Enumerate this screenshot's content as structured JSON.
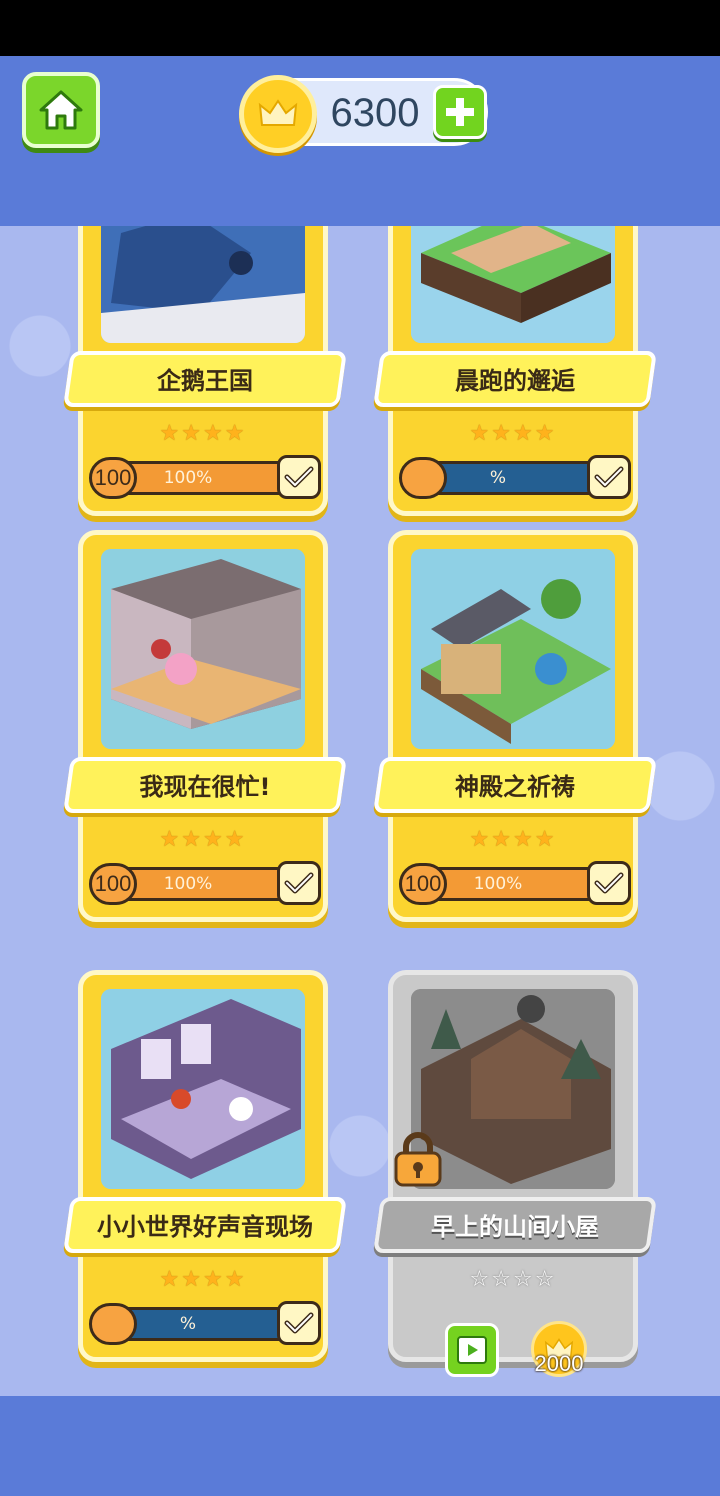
{
  "header": {
    "coins": "6300"
  },
  "colors": {
    "header": "#5a7bd8",
    "card": "#fbd42f",
    "locked_card": "#c9c9c9",
    "progress_fill": "#f39a35",
    "progress_track": "#245f92"
  },
  "levels": [
    {
      "title": "企鹅王国",
      "stars": "★★★★",
      "badge": "100",
      "progress_text": "100%",
      "progress": 1.0,
      "completed": true,
      "locked": false
    },
    {
      "title": "晨跑的邂逅",
      "stars": "★★★★",
      "badge": "",
      "progress_text": "%",
      "progress": 0.0,
      "completed": true,
      "locked": false
    },
    {
      "title": "我现在很忙!",
      "stars": "★★★★",
      "badge": "100",
      "progress_text": "100%",
      "progress": 1.0,
      "completed": true,
      "locked": false
    },
    {
      "title": "神殿之祈祷",
      "stars": "★★★★",
      "badge": "100",
      "progress_text": "100%",
      "progress": 1.0,
      "completed": true,
      "locked": false
    },
    {
      "title": "小小世界好声音现场",
      "stars": "★★★★",
      "badge": "",
      "progress_text": "%",
      "progress": 0.0,
      "completed": true,
      "locked": false
    },
    {
      "title": "早上的山间小屋",
      "stars": "☆☆☆☆",
      "locked": true,
      "unlock_price": "2000"
    }
  ],
  "icons": {
    "home": "home-icon",
    "coin": "crown-coin-icon",
    "plus": "plus-icon",
    "check": "check-icon",
    "lock": "lock-icon",
    "video": "video-icon"
  }
}
